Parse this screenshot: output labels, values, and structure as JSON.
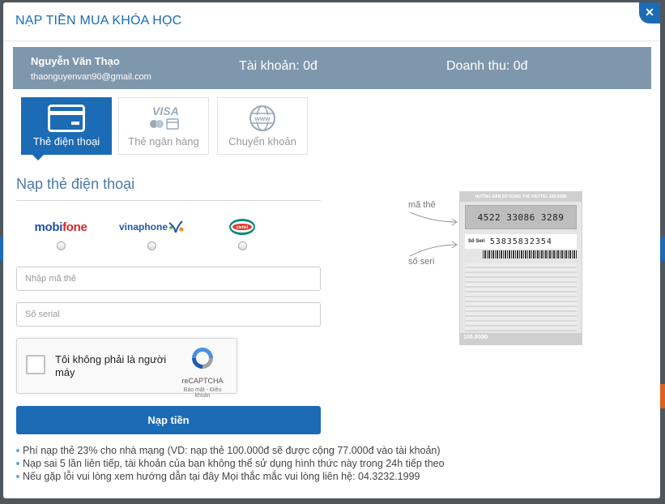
{
  "modal": {
    "title": "NẠP TIỀN MUA KHÓA HỌC",
    "close_glyph": "✕"
  },
  "user": {
    "name": "Nguyễn Văn Thạo",
    "email": "thaonguyenvan90@gmail.com",
    "account": "Tài khoản: 0đ",
    "revenue": "Doanh thu: 0đ"
  },
  "tabs": [
    {
      "label": "Thẻ điện thoại",
      "icon": "credit-card-icon",
      "active": true
    },
    {
      "label": "Thẻ ngân hàng",
      "icon": "visa-mastercard-icon",
      "active": false
    },
    {
      "label": "Chuyển khoản",
      "icon": "www-globe-icon",
      "active": false
    }
  ],
  "form": {
    "section_title": "Nạp thẻ điện thoại",
    "carriers": [
      {
        "brand_a": "mobi",
        "brand_b": "fone"
      },
      {
        "brand_a": "vinaphone"
      },
      {
        "brand_a": "viettel"
      }
    ],
    "code_placeholder": "Nhập mã thẻ",
    "serial_placeholder": "Số serial",
    "submit_label": "Nạp tiền"
  },
  "captcha": {
    "label": "Tôi không phải là người máy",
    "brand": "reCAPTCHA",
    "links": "Bảo mật - Điều khoản"
  },
  "notes": [
    "Phí nạp thẻ 23% cho nhà mạng (VD: nạp thẻ 100.000đ sẽ được cộng 77.000đ vào tài khoản)",
    "Nạp sai 5 lần liên tiếp, tài khoản của bạn không thể sử dụng hình thức này trong 24h tiếp theo",
    "Nếu gặp lỗi vui lòng xem hướng dẫn tại đây Mọi thắc mắc vui lòng liên hệ: 04.3232.1999"
  ],
  "card_illustration": {
    "code_label": "mã thẻ",
    "serial_label": "số seri",
    "header": "HƯỚNG DẪN SỬ DỤNG THẺ VIETTEL 100.000Đ",
    "code_value": "4522 33086 3289",
    "serial_caption": "Số Seri",
    "serial_value": "53835832354",
    "denomination": "100.000Đ"
  },
  "colors": {
    "accent": "#1c6bb5",
    "user_bar": "#7f97ac"
  }
}
